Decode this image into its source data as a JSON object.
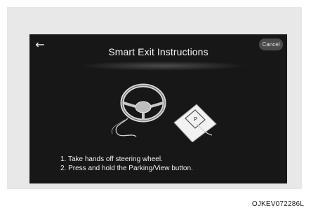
{
  "screen": {
    "title": "Smart Exit Instructions",
    "back_icon": "←",
    "cancel_label": "Cancel",
    "illustration_icons": [
      "steering-wheel-icon",
      "parking-view-button-icon"
    ],
    "instructions": [
      "1. Take hands off steering wheel.",
      "2. Press and hold the Parking/View button."
    ]
  },
  "image_code": "OJKEV072286L"
}
